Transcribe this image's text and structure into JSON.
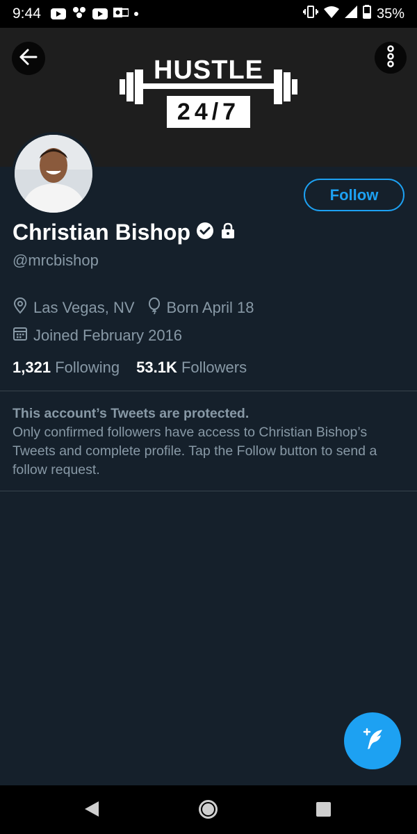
{
  "status_bar": {
    "time": "9:44",
    "battery": "35%",
    "icons_left": [
      "youtube-icon",
      "pinwheel-icon",
      "youtube-icon",
      "outlook-icon",
      "dot-icon"
    ],
    "icons_right": [
      "vibrate-icon",
      "wifi-icon",
      "signal-icon",
      "battery-icon"
    ]
  },
  "banner": {
    "logo_title": "HUSTLE",
    "logo_sub": "24/7"
  },
  "profile": {
    "name": "Christian Bishop",
    "handle": "@mrcbishop",
    "follow_label": "Follow",
    "location": "Las Vegas, NV",
    "birthday": "Born April 18",
    "joined": "Joined February 2016",
    "following_count": "1,321",
    "following_label": "Following",
    "followers_count": "53.1K",
    "followers_label": "Followers"
  },
  "protected_notice": {
    "title": "This account’s Tweets are protected.",
    "body": "Only confirmed followers have access to Christian Bishop’s Tweets and complete profile. Tap the Follow button to send a follow request."
  },
  "colors": {
    "background": "#15202b",
    "accent": "#1da1f2",
    "secondary_text": "#8899a6",
    "divider": "#38444d"
  }
}
